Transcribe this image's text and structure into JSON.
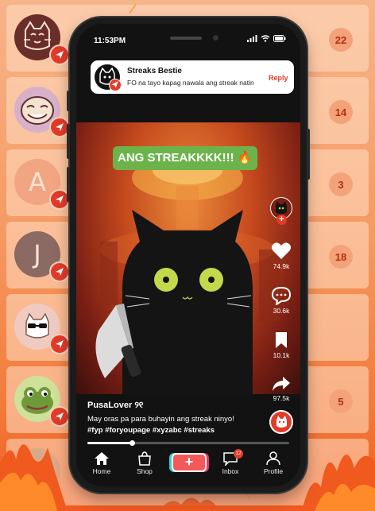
{
  "background_chats": [
    {
      "avatar": "cat-drawing",
      "avatar_color": "#6a2e2a",
      "count": "22"
    },
    {
      "avatar": "meme-face",
      "avatar_color": "#d8b0c8",
      "count": "14"
    },
    {
      "avatar": "letter",
      "letter": "A",
      "avatar_color": "#f2a582",
      "count": "3"
    },
    {
      "avatar": "letter",
      "letter": "J",
      "avatar_color": "#8a6a62",
      "count": "18"
    },
    {
      "avatar": "cool-cat",
      "avatar_color": "#f0c9c0",
      "count": ""
    },
    {
      "avatar": "frog",
      "avatar_color": "#cfe09a",
      "count": "5"
    },
    {
      "avatar": "cat-photo",
      "avatar_color": "#d9a887",
      "count": ""
    }
  ],
  "status_bar": {
    "time": "11:53PM"
  },
  "notification": {
    "title": "Streaks Bestie",
    "message": "FO na tayo kapag nawala ang streak natin",
    "reply_label": "Reply"
  },
  "video": {
    "sticker_text": "ANG STREAKKKK!!!",
    "sticker_emoji": "🔥"
  },
  "actions": {
    "likes": "74.9k",
    "comments": "30.6k",
    "saves": "10.1k",
    "shares": "97.5k"
  },
  "post": {
    "username": "PusaLover",
    "username_symbol": "୨୧",
    "caption": "May oras pa para buhayin ang streak ninyo!",
    "hashtags": "#fyp #foryoupage #xyzabc #streaks",
    "progress": 0.22
  },
  "nav": {
    "home": "Home",
    "shop": "Shop",
    "create": "+",
    "inbox": "Inbox",
    "inbox_badge": "12",
    "profile": "Profile"
  },
  "colors": {
    "accent_red": "#e23b2a",
    "sticker_green": "#6cb34b",
    "background_orange": "#f59a64"
  }
}
